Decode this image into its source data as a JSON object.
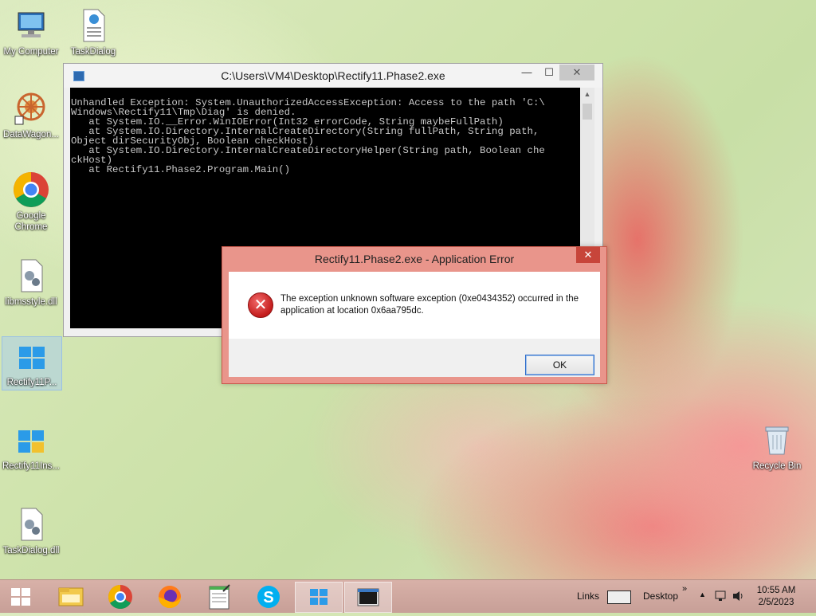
{
  "desktop": {
    "icons": [
      {
        "label": "My Computer",
        "icon": "computer-icon"
      },
      {
        "label": "TaskDialog",
        "icon": "html-document-icon"
      },
      {
        "label": "DataWagon...",
        "icon": "datawagon-icon"
      },
      {
        "label": "Google Chrome",
        "icon": "chrome-icon"
      },
      {
        "label": "libmsstyle.dll",
        "icon": "dll-file-icon"
      },
      {
        "label": "Rectify11P...",
        "icon": "rectify11-icon"
      },
      {
        "label": "Rectify11Ins...",
        "icon": "rectify11-installer-icon"
      },
      {
        "label": "TaskDialog.dll",
        "icon": "dll-file-icon"
      },
      {
        "label": "Recycle Bin",
        "icon": "recycle-bin-icon"
      }
    ]
  },
  "console": {
    "title": "C:\\Users\\VM4\\Desktop\\Rectify11.Phase2.exe",
    "output": "Unhandled Exception: System.UnauthorizedAccessException: Access to the path 'C:\\\nWindows\\Rectify11\\Tmp\\Diag' is denied.\n   at System.IO.__Error.WinIOError(Int32 errorCode, String maybeFullPath)\n   at System.IO.Directory.InternalCreateDirectory(String fullPath, String path,\nObject dirSecurityObj, Boolean checkHost)\n   at System.IO.Directory.InternalCreateDirectoryHelper(String path, Boolean che\nckHost)\n   at Rectify11.Phase2.Program.Main()",
    "minimize": "—",
    "maximize": "☐",
    "close": "✕"
  },
  "dialog": {
    "title": "Rectify11.Phase2.exe - Application Error",
    "message": "The exception unknown software exception (0xe0434352) occurred in the application at location 0x6aa795dc.",
    "ok_label": "OK",
    "close": "✕",
    "icon": "error-icon"
  },
  "taskbar": {
    "links_label": "Links",
    "desktop_label": "Desktop",
    "chevron": "»",
    "tray_arrow": "▲",
    "time": "10:55 AM",
    "date": "2/5/2023",
    "pinned": [
      "file-explorer-icon",
      "chrome-icon",
      "firefox-icon",
      "notepad-icon",
      "skype-icon",
      "rectify11-icon",
      "console-icon"
    ]
  }
}
